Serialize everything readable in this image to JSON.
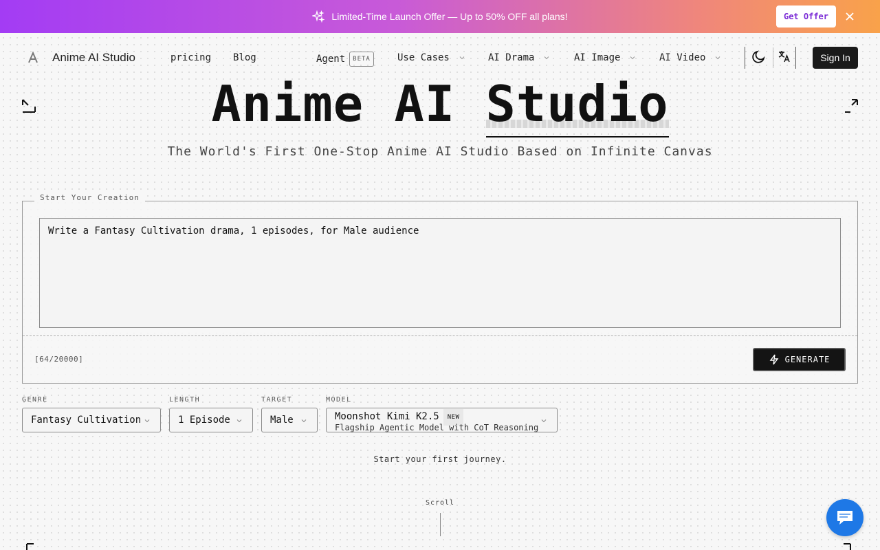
{
  "banner": {
    "text": "Limited-Time Launch Offer — Up to 50% OFF all plans!",
    "cta": "Get Offer"
  },
  "nav": {
    "brand": "Anime AI Studio",
    "links": [
      "pricing",
      "Blog"
    ],
    "agent": "Agent",
    "agent_badge": "BETA",
    "dropdowns": [
      "Use Cases",
      "AI Drama",
      "AI Image",
      "AI Video"
    ],
    "sign_in": "Sign In"
  },
  "hero": {
    "title_part1": "Anime AI",
    "title_highlight": "Studio",
    "subtitle": "The World's First One-Stop Anime AI Studio Based on Infinite Canvas"
  },
  "creation": {
    "legend": "Start Your Creation",
    "prompt": "Write a Fantasy Cultivation drama, 1 episodes, for Male audience",
    "counter": "[64/20000]",
    "generate": "GENERATE"
  },
  "options": {
    "genre_label": "GENRE",
    "genre_value": "Fantasy Cultivation",
    "length_label": "LENGTH",
    "length_value": "1 Episode",
    "target_label": "TARGET",
    "target_value": "Male",
    "model_label": "MODEL",
    "model_name": "Moonshot Kimi K2.5",
    "model_badge": "NEW",
    "model_desc": "Flagship Agentic Model with CoT Reasoning"
  },
  "footer": {
    "journey": "Start your first journey.",
    "scroll": "Scroll"
  },
  "colors": {
    "banner_start": "#a33cf4",
    "banner_end": "#f9a24a",
    "offer_text": "#7b2cd6",
    "chat_button": "#1e78e6",
    "dark": "#141414"
  },
  "icons": [
    "sparkle-icon",
    "close-icon",
    "logo-icon",
    "chevron-down-icon",
    "moon-icon",
    "translate-icon",
    "lightning-icon",
    "chat-icon",
    "corner-bracket-icon"
  ]
}
